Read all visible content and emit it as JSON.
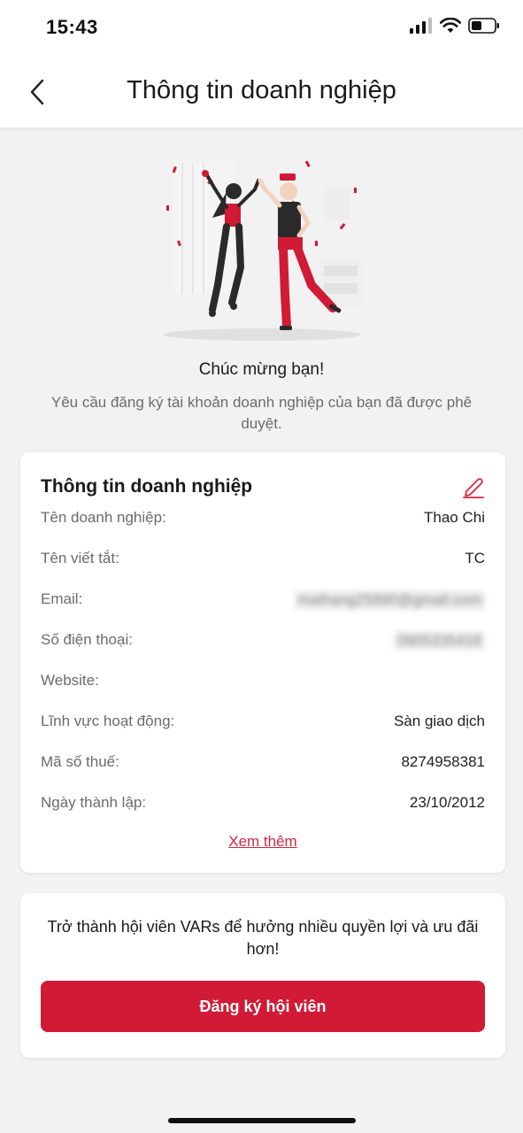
{
  "status_bar": {
    "time": "15:43"
  },
  "header": {
    "title": "Thông tin doanh nghiệp"
  },
  "congrats": {
    "title": "Chúc mừng bạn!",
    "message": "Yêu cầu đăng ký tài khoản doanh nghiệp của bạn đã được phê duyệt."
  },
  "info_card": {
    "title": "Thông tin doanh nghiệp",
    "rows": [
      {
        "label": "Tên doanh nghiệp:",
        "value": "Thao Chi"
      },
      {
        "label": "Tên viết tắt:",
        "value": "TC"
      },
      {
        "label": "Email:",
        "value": "maihang25890@gmail.com"
      },
      {
        "label": "Số điện thoại:",
        "value": "0905335416"
      },
      {
        "label": "Website:",
        "value": ""
      },
      {
        "label": "Lĩnh vực hoạt động:",
        "value": "Sàn giao dịch"
      },
      {
        "label": "Mã số thuế:",
        "value": "8274958381"
      },
      {
        "label": "Ngày thành lập:",
        "value": "23/10/2012"
      }
    ],
    "see_more": "Xem thêm"
  },
  "member_card": {
    "message": "Trở thành hội viên VARs để hưởng nhiều quyền lợi và ưu đãi hơn!",
    "button": "Đăng ký hội viên"
  },
  "colors": {
    "accent": "#d11a35",
    "link": "#d6263e",
    "background": "#f2f2f2"
  },
  "icons": [
    "back-chevron-icon",
    "edit-pencil-icon",
    "signal-icon",
    "wifi-icon",
    "battery-icon"
  ]
}
